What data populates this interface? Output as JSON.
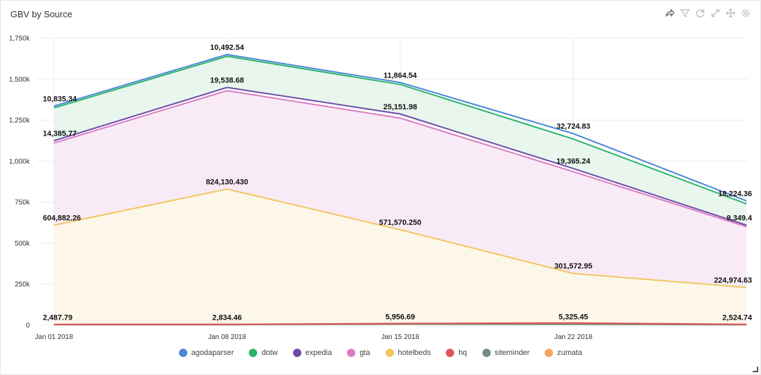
{
  "panel": {
    "title": "GBV by Source",
    "toolbar": [
      {
        "name": "share-icon"
      },
      {
        "name": "filter-icon"
      },
      {
        "name": "refresh-icon"
      },
      {
        "name": "expand-icon"
      },
      {
        "name": "move-icon"
      },
      {
        "name": "gear-icon"
      }
    ]
  },
  "chart_data": {
    "type": "area",
    "stacked": true,
    "title": "GBV by Source",
    "x": [
      "2018-01-01",
      "2018-01-08",
      "2018-01-15",
      "2018-01-22",
      "2018-01-29"
    ],
    "x_tick_labels": [
      "Jan 01 2018",
      "Jan 08 2018",
      "Jan 15 2018",
      "Jan 22 2018"
    ],
    "y_tick_labels": [
      "0",
      "250k",
      "500k",
      "750k",
      "1,000k",
      "1,250k",
      "1,500k",
      "1,750k"
    ],
    "y_ticks": [
      0,
      250000,
      500000,
      750000,
      1000000,
      1250000,
      1500000,
      1750000
    ],
    "ylim": [
      0,
      1750000
    ],
    "grid": true,
    "legend_position": "bottom",
    "series": [
      {
        "name": "zumata",
        "color": "#f4a460",
        "values": [
          2487.79,
          2834.46,
          5956.69,
          5325.45,
          2524.74
        ],
        "labels": [
          "2,487.79",
          "2,834.46",
          "5,956.69",
          "5,325.45",
          "2,524.74"
        ]
      },
      {
        "name": "siteminder",
        "color": "#778888",
        "values": [
          500,
          500,
          500,
          500,
          500
        ],
        "labels": []
      },
      {
        "name": "hq",
        "color": "#e05555",
        "values": [
          2000,
          2000,
          4000,
          8000,
          2000
        ],
        "labels": []
      },
      {
        "name": "hotelbeds",
        "color": "#f2c661",
        "values": [
          604882.26,
          824130.43,
          571570.25,
          301572.95,
          224974.63
        ],
        "labels": [
          "604,882.26",
          "824,130.430",
          "571,570.250",
          "301,572.95",
          "224,974.63"
        ]
      },
      {
        "name": "gta",
        "color": "#d97bc2",
        "values": [
          500000,
          600000,
          680000,
          620000,
          370000
        ],
        "labels": []
      },
      {
        "name": "expedia",
        "color": "#6f4aa8",
        "values": [
          14385.77,
          19538.68,
          25151.98,
          19365.24,
          9349.4
        ],
        "labels": [
          "14,385.77",
          "19,538.68",
          "25,151.98",
          "19,365.24",
          "9,349.4"
        ]
      },
      {
        "name": "dotw",
        "color": "#2bb36b",
        "values": [
          200000,
          190000,
          180000,
          180000,
          130000
        ],
        "labels": []
      },
      {
        "name": "agodaparser",
        "color": "#4a86d8",
        "values": [
          10835.34,
          10492.54,
          11864.54,
          32724.83,
          18224.36
        ],
        "labels": [
          "10,835.34",
          "10,492.54",
          "11,864.54",
          "32,724.83",
          "18,224.36"
        ]
      }
    ],
    "legend_order": [
      "agodaparser",
      "dotw",
      "expedia",
      "gta",
      "hotelbeds",
      "hq",
      "siteminder",
      "zumata"
    ],
    "fills": {
      "dotw": "#e8f6ee",
      "gta": "#f9ebf6",
      "hotelbeds": "#fdf7ea"
    }
  }
}
